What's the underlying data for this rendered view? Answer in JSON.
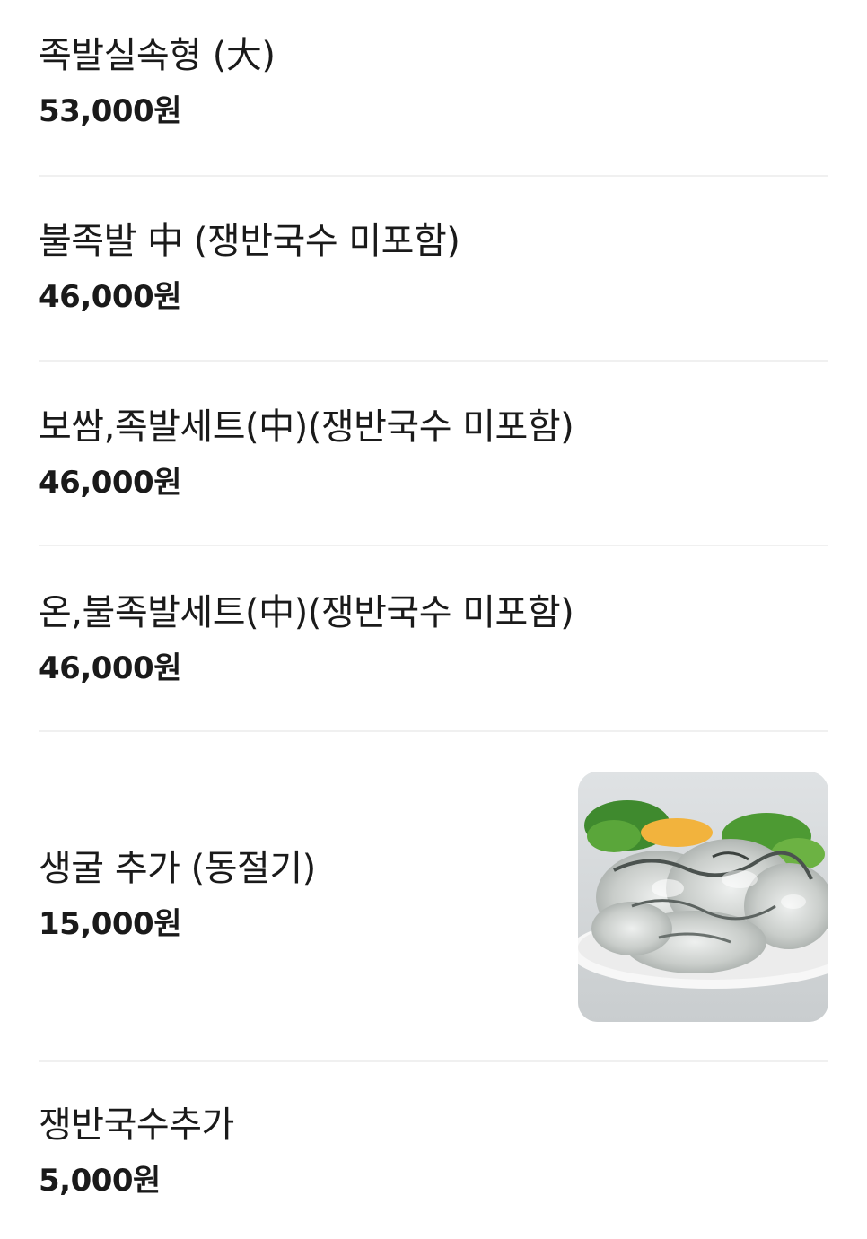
{
  "menu": {
    "items": [
      {
        "name": "족발실속형 (大)",
        "price": "53,000원"
      },
      {
        "name": "불족발 中 (쟁반국수 미포함)",
        "price": "46,000원"
      },
      {
        "name": "보쌈,족발세트(中)(쟁반국수 미포함)",
        "price": "46,000원"
      },
      {
        "name": "온,불족발세트(中)(쟁반국수 미포함)",
        "price": "46,000원"
      },
      {
        "name": "생굴 추가 (동절기)",
        "price": "15,000원",
        "image": "oyster-dish-photo"
      },
      {
        "name": "쟁반국수추가",
        "price": "5,000원"
      }
    ]
  }
}
